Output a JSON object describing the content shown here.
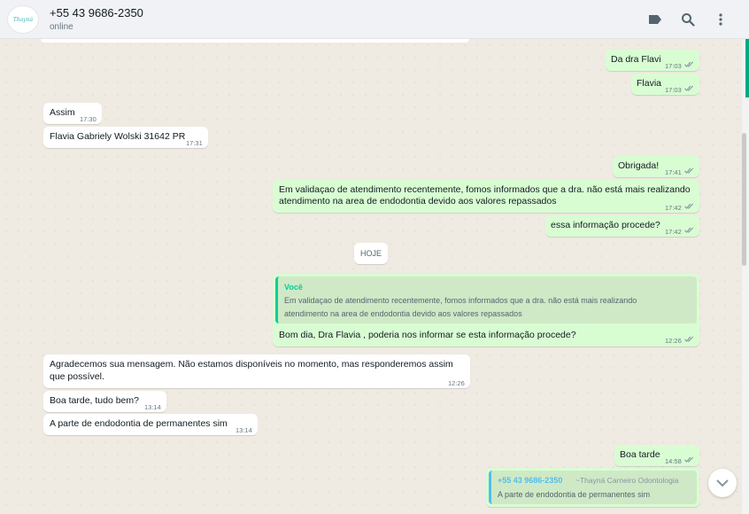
{
  "header": {
    "avatar_text": "Thayná",
    "contact_name": "+55 43 9686-2350",
    "status": "online",
    "icons": [
      "label-icon",
      "search-icon",
      "menu-icon"
    ]
  },
  "messages": [
    {
      "dir": "out",
      "text": "Da dra Flavi",
      "time": "17:03",
      "read": true
    },
    {
      "dir": "out",
      "text": "Flavia",
      "time": "17:03",
      "read": true
    },
    {
      "dir": "in",
      "text": "Assim",
      "time": "17:30"
    },
    {
      "dir": "in",
      "text": "Flavia Gabriely Wolski 31642 PR",
      "time": "17:31"
    },
    {
      "dir": "out",
      "text": "Obrigada!",
      "time": "17:41",
      "read": true
    },
    {
      "dir": "out",
      "lines": [
        "Em validaçao de atendimento recentemente, fomos informados que a dra. não está mais realizando",
        "atendimento na area de endodontia devido aos valores repassados"
      ],
      "time": "17:42",
      "read": true
    },
    {
      "dir": "out",
      "text": "essa informação procede?",
      "time": "17:42",
      "read": true
    },
    {
      "dir": "out",
      "quote_author": "Você",
      "quote_lines": [
        "Em validaçao de atendimento recentemente, fomos informados que a dra. não está mais realizando",
        "atendimento na area de endodontia devido aos valores repassados"
      ],
      "text": "Bom dia, Dra Flavia , poderia nos informar se esta informação procede?",
      "time": "12:26",
      "read": true
    },
    {
      "dir": "in",
      "lines": [
        "Agradecemos sua mensagem. Não estamos disponíveis no momento, mas responderemos assim",
        "que possível."
      ],
      "time": "12:26"
    },
    {
      "dir": "in",
      "text": "Boa tarde, tudo bem?",
      "time": "13:14"
    },
    {
      "dir": "in",
      "text": "A parte de endodontia de permanentes sim",
      "time": "13:14"
    },
    {
      "dir": "out",
      "text": "Boa tarde",
      "time": "14:58",
      "read": true
    },
    {
      "dir": "out",
      "quote_author": "+55 43 9686-2350",
      "quote_sub": "~Thayná Carneiro Odontologia",
      "quote_lines": [
        "A parte de endodontia de permanentes sim"
      ]
    }
  ],
  "date_separator": "HOJE",
  "colors": {
    "outgoing": "#d9fdd3",
    "incoming": "#ffffff",
    "read_tick": "#53bdeb",
    "accent": "#00a884",
    "quote_author_green": "#06cf9c",
    "quote_author_blue": "#53bdeb"
  }
}
